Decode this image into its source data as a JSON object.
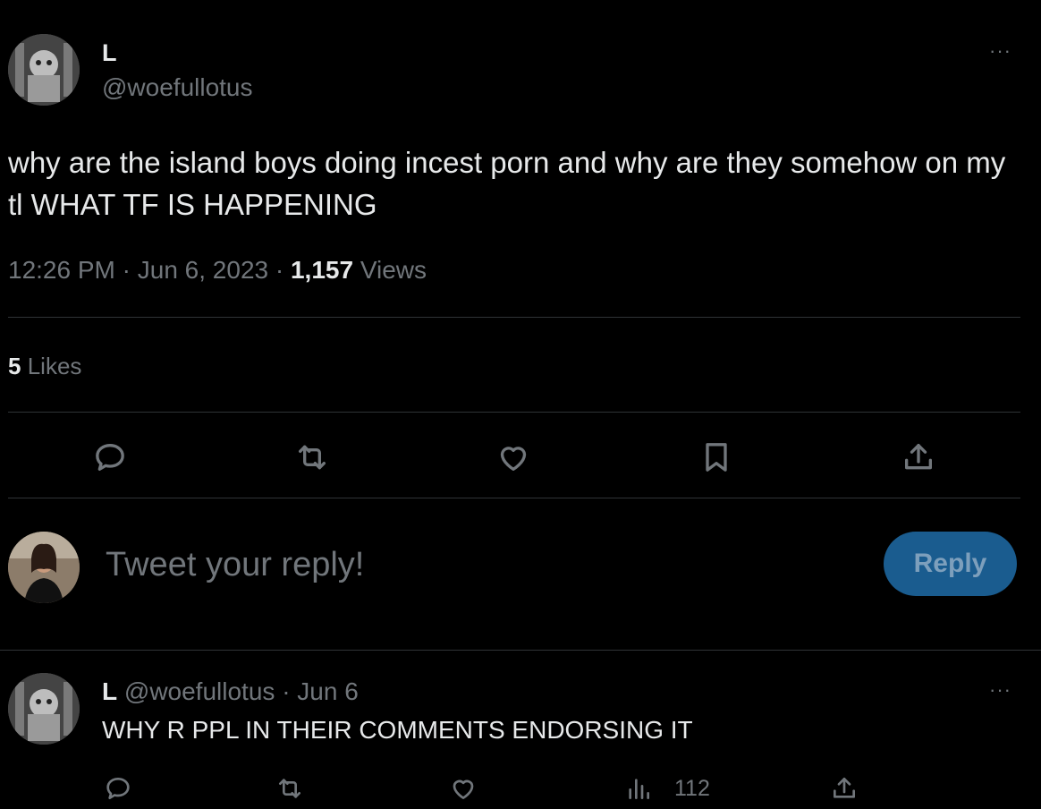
{
  "tweet": {
    "author_name": "L",
    "author_handle": "@woefullotus",
    "text": "why are the island boys doing incest porn and why are they somehow on my tl WHAT TF IS HAPPENING",
    "time": "12:26 PM",
    "sep1": "·",
    "date": "Jun 6, 2023",
    "sep2": "·",
    "views_count": "1,157",
    "views_label": "Views",
    "likes_count": "5",
    "likes_label": "Likes",
    "more": "···"
  },
  "composer": {
    "placeholder": "Tweet your reply!",
    "reply_label": "Reply"
  },
  "reply": {
    "author_name": "L",
    "author_handle": "@woefullotus",
    "sep": "·",
    "date": "Jun 6",
    "text": "WHY R PPL IN THEIR COMMENTS ENDORSING IT",
    "views_count": "112",
    "more": "···"
  },
  "icons": {
    "reply": "reply-icon",
    "retweet": "retweet-icon",
    "like": "heart-icon",
    "bookmark": "bookmark-icon",
    "share": "share-icon",
    "views": "views-icon"
  },
  "colors": {
    "background": "#000000",
    "text": "#e7e9ea",
    "muted": "#71767b",
    "reply_button": "#1a5c8f"
  }
}
